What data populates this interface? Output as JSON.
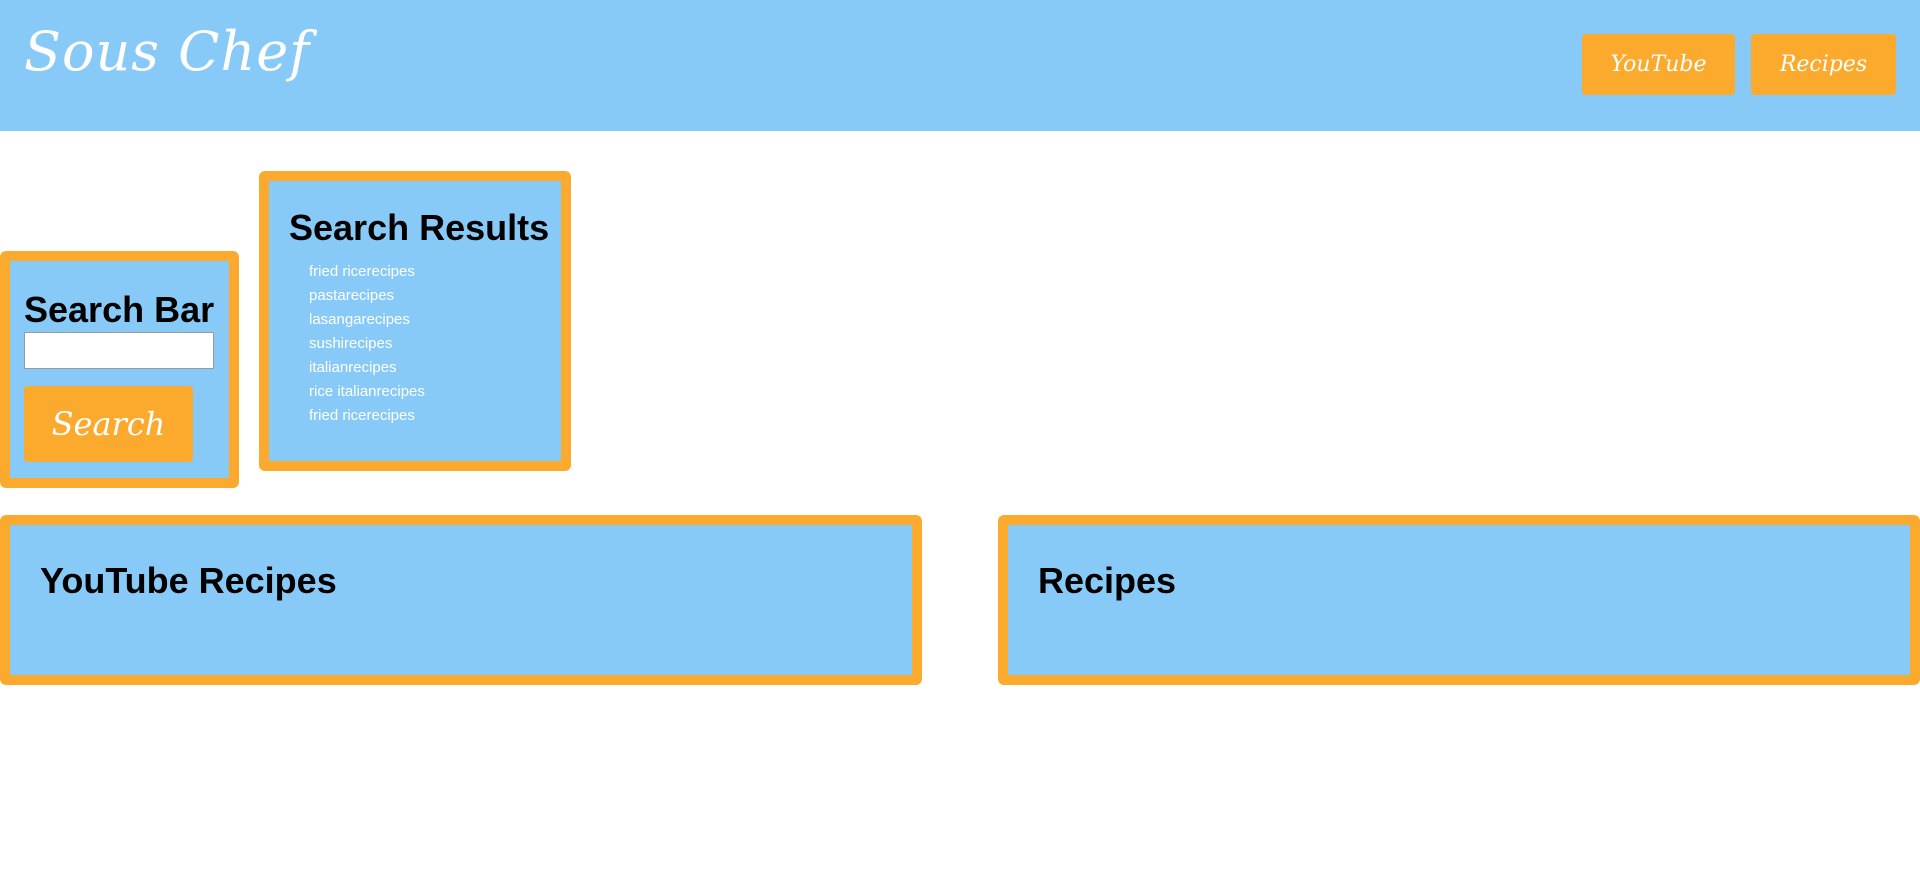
{
  "header": {
    "brand": "Sous Chef",
    "nav": {
      "youtube_label": "YouTube",
      "recipes_label": "Recipes"
    }
  },
  "search_bar": {
    "title": "Search Bar",
    "input_value": "",
    "button_label": "Search"
  },
  "search_results": {
    "title": "Search Results",
    "items": [
      "fried ricerecipes",
      "pastarecipes",
      "lasangarecipes",
      "sushirecipes",
      "italianrecipes",
      "rice italianrecipes",
      "fried ricerecipes"
    ]
  },
  "youtube_recipes": {
    "title": "YouTube Recipes"
  },
  "recipes": {
    "title": "Recipes"
  },
  "colors": {
    "panel_blue": "#88CAF7",
    "accent_orange": "#FBAA2D",
    "text_white": "#ffffff",
    "heading_black": "#000000"
  }
}
